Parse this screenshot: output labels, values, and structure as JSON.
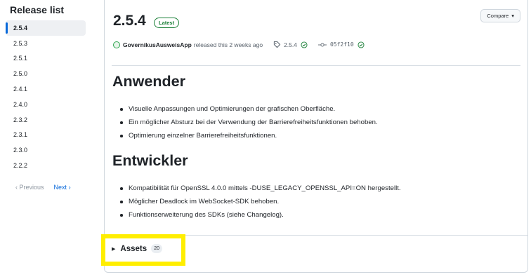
{
  "sidebar": {
    "title": "Release list",
    "items": [
      {
        "label": "2.5.4",
        "active": true
      },
      {
        "label": "2.5.3"
      },
      {
        "label": "2.5.1"
      },
      {
        "label": "2.5.0"
      },
      {
        "label": "2.4.1"
      },
      {
        "label": "2.4.0"
      },
      {
        "label": "2.3.2"
      },
      {
        "label": "2.3.1"
      },
      {
        "label": "2.3.0"
      },
      {
        "label": "2.2.2"
      }
    ],
    "pager": {
      "previous": "Previous",
      "next": "Next"
    }
  },
  "release": {
    "title": "2.5.4",
    "badge": "Latest",
    "compare_label": "Compare",
    "author": "GovernikusAusweisApp",
    "released_text": "released this 2 weeks ago",
    "tag": "2.5.4",
    "commit": "05f2f10"
  },
  "sections": [
    {
      "heading": "Anwender",
      "bullets": [
        "Visuelle Anpassungen und Optimierungen der grafischen Oberfläche.",
        "Ein möglicher Absturz bei der Verwendung der Barrierefreiheitsfunktionen behoben.",
        "Optimierung einzelner Barrierefreiheitsfunktionen."
      ]
    },
    {
      "heading": "Entwickler",
      "bullets": [
        "Kompatibilität für OpenSSL 4.0.0 mittels -DUSE_LEGACY_OPENSSL_API=ON hergestellt.",
        "Möglicher Deadlock im WebSocket-SDK behoben.",
        "Funktionserweiterung des SDKs (siehe Changelog)."
      ]
    }
  ],
  "assets": {
    "label": "Assets",
    "count": "20"
  },
  "colors": {
    "accent": "#0969da",
    "success": "#1a7f37",
    "highlight": "#ffee00"
  }
}
